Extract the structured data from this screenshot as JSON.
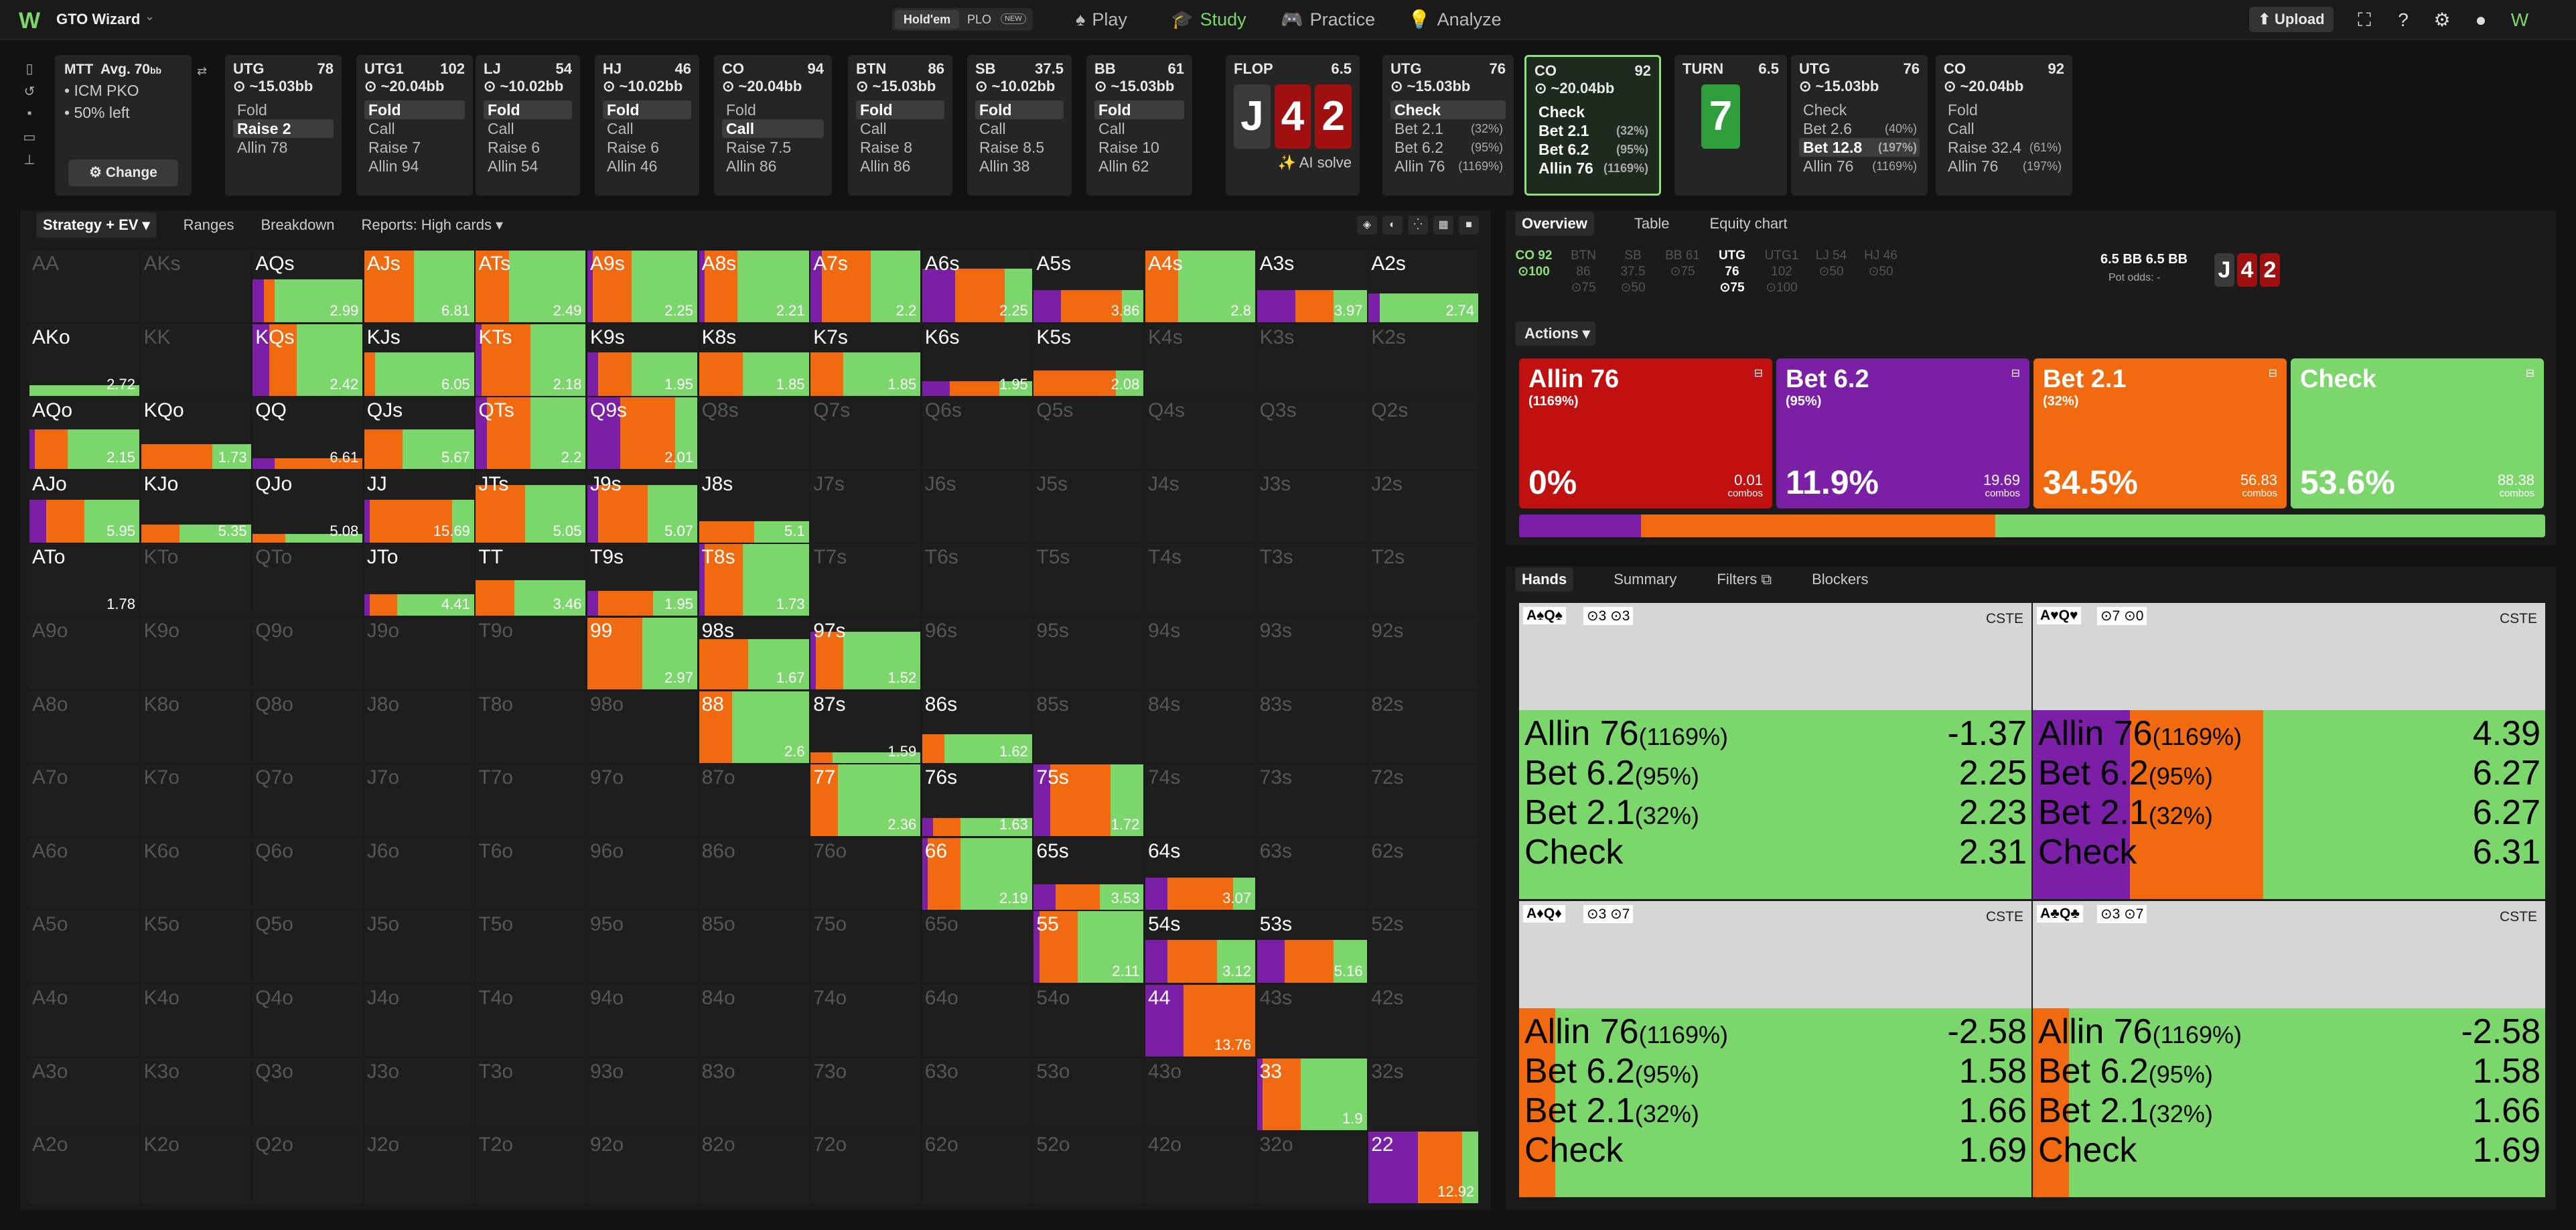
{
  "app": {
    "logo": "W",
    "title": "GTO Wizard",
    "mode_active": "Hold'em",
    "mode_other": "PLO",
    "mode_badge": "NEW"
  },
  "nav": [
    {
      "label": "Play",
      "icon": "spade-icon",
      "glyph": "♠"
    },
    {
      "label": "Study",
      "icon": "graduation-cap-icon",
      "glyph": "🎓"
    },
    {
      "label": "Practice",
      "icon": "gamepad-icon",
      "glyph": "🎮"
    },
    {
      "label": "Analyze",
      "icon": "bulb-icon",
      "glyph": "💡"
    }
  ],
  "toolbar": {
    "upload": "⬆ Upload"
  },
  "summary": {
    "title": "MTT",
    "avg": "Avg. 70",
    "avg_unit": "bb",
    "line1": "• ICM PKO",
    "line2": "• 50% left",
    "change": "⚙ Change"
  },
  "positions": [
    {
      "name": "UTG",
      "num": "78",
      "stack": "~15.03bb",
      "acts": [
        {
          "t": "Fold"
        },
        {
          "t": "Raise 2",
          "sel": true
        },
        {
          "t": "Allin 78"
        }
      ]
    },
    {
      "name": "UTG1",
      "num": "102",
      "stack": "~20.04bb",
      "acts": [
        {
          "t": "Fold",
          "sel": true
        },
        {
          "t": "Call"
        },
        {
          "t": "Raise 7"
        },
        {
          "t": "Allin 94"
        }
      ]
    },
    {
      "name": "LJ",
      "num": "54",
      "stack": "~10.02bb",
      "acts": [
        {
          "t": "Fold",
          "sel": true
        },
        {
          "t": "Call"
        },
        {
          "t": "Raise 6"
        },
        {
          "t": "Allin 54"
        }
      ]
    },
    {
      "name": "HJ",
      "num": "46",
      "stack": "~10.02bb",
      "acts": [
        {
          "t": "Fold",
          "sel": true
        },
        {
          "t": "Call"
        },
        {
          "t": "Raise 6"
        },
        {
          "t": "Allin 46"
        }
      ]
    },
    {
      "name": "CO",
      "num": "94",
      "stack": "~20.04bb",
      "acts": [
        {
          "t": "Fold"
        },
        {
          "t": "Call",
          "sel": true
        },
        {
          "t": "Raise 7.5"
        },
        {
          "t": "Allin 86"
        }
      ]
    },
    {
      "name": "BTN",
      "num": "86",
      "stack": "~15.03bb",
      "acts": [
        {
          "t": "Fold",
          "sel": true
        },
        {
          "t": "Call"
        },
        {
          "t": "Raise 8"
        },
        {
          "t": "Allin 86"
        }
      ]
    },
    {
      "name": "SB",
      "num": "37.5",
      "stack": "~10.02bb",
      "acts": [
        {
          "t": "Fold",
          "sel": true
        },
        {
          "t": "Call"
        },
        {
          "t": "Raise 8.5"
        },
        {
          "t": "Allin 38"
        }
      ]
    },
    {
      "name": "BB",
      "num": "61",
      "stack": "~15.03bb",
      "acts": [
        {
          "t": "Fold",
          "sel": true
        },
        {
          "t": "Call"
        },
        {
          "t": "Raise 10"
        },
        {
          "t": "Allin 62"
        }
      ]
    }
  ],
  "flop": {
    "label": "FLOP",
    "pot": "6.5",
    "cards": [
      "J",
      "4",
      "2"
    ],
    "ai": "✨ AI solve"
  },
  "utg_flop": {
    "name": "UTG",
    "num": "76",
    "stack": "~15.03bb",
    "acts": [
      {
        "t": "Check",
        "sel": true
      },
      {
        "t": "Bet 2.1",
        "p": "(32%)"
      },
      {
        "t": "Bet 6.2",
        "p": "(95%)"
      },
      {
        "t": "Allin 76",
        "p": "(1169%)"
      }
    ]
  },
  "co_flop": {
    "name": "CO",
    "num": "92",
    "stack": "~20.04bb",
    "acts": [
      {
        "t": "Check"
      },
      {
        "t": "Bet 2.1",
        "p": "(32%)"
      },
      {
        "t": "Bet 6.2",
        "p": "(95%)"
      },
      {
        "t": "Allin 76",
        "p": "(1169%)"
      }
    ]
  },
  "turn": {
    "label": "TURN",
    "pot": "6.5",
    "card": "7"
  },
  "utg_turn": {
    "name": "UTG",
    "num": "76",
    "stack": "~15.03bb",
    "acts": [
      {
        "t": "Check"
      },
      {
        "t": "Bet 2.6",
        "p": "(40%)"
      },
      {
        "t": "Bet 12.8",
        "p": "(197%)",
        "sel": true
      },
      {
        "t": "Allin 76",
        "p": "(1169%)"
      }
    ]
  },
  "co_turn": {
    "name": "CO",
    "num": "92",
    "stack": "~20.04bb",
    "acts": [
      {
        "t": "Fold"
      },
      {
        "t": "Call"
      },
      {
        "t": "Raise 32.4",
        "p": "(61%)"
      },
      {
        "t": "Allin 76",
        "p": "(197%)"
      }
    ]
  },
  "matrix_tabs": [
    "Strategy + EV ▾",
    "Ranges",
    "Breakdown",
    "Reports: High cards ▾"
  ],
  "matrix": {
    "ranks": [
      "A",
      "K",
      "Q",
      "J",
      "T",
      "9",
      "8",
      "7",
      "6",
      "5",
      "4",
      "3",
      "2"
    ],
    "colors": {
      "allin": "#7a1fa6",
      "bet": "#f26a10",
      "check": "#7bd66b",
      "allinred": "#c01010"
    },
    "cells": {
      "AQs": {
        "ev": "2.99",
        "h": 0.6,
        "s": [
          0.1,
          0.1,
          0.8
        ]
      },
      "AJs": {
        "ev": "6.81",
        "h": 1,
        "s": [
          0,
          0.45,
          0.55
        ]
      },
      "ATs": {
        "ev": "2.49",
        "h": 1,
        "s": [
          0,
          0.3,
          0.7
        ]
      },
      "A9s": {
        "ev": "2.25",
        "h": 1,
        "s": [
          0.05,
          0.35,
          0.6
        ]
      },
      "A8s": {
        "ev": "2.21",
        "h": 1,
        "s": [
          0.05,
          0.3,
          0.65
        ]
      },
      "A7s": {
        "ev": "2.2",
        "h": 1,
        "s": [
          0.1,
          0.45,
          0.45
        ]
      },
      "A6s": {
        "ev": "2.25",
        "h": 0.75,
        "s": [
          0.3,
          0.45,
          0.25
        ]
      },
      "A5s": {
        "ev": "3.86",
        "h": 0.45,
        "s": [
          0.25,
          0.55,
          0.2
        ]
      },
      "A4s": {
        "ev": "2.8",
        "h": 1,
        "s": [
          0,
          0.3,
          0.7
        ]
      },
      "A3s": {
        "ev": "3.97",
        "h": 0.45,
        "s": [
          0.35,
          0.35,
          0.3
        ]
      },
      "A2s": {
        "ev": "2.74",
        "h": 0.4,
        "s": [
          0.1,
          0,
          0.9
        ]
      },
      "AKo": {
        "ev": "2.72",
        "h": 0.15,
        "s": [
          0,
          0,
          1
        ]
      },
      "KQs": {
        "ev": "2.42",
        "h": 1,
        "s": [
          0.15,
          0.25,
          0.6
        ]
      },
      "KJs": {
        "ev": "6.05",
        "h": 0.6,
        "s": [
          0,
          0.1,
          0.9
        ]
      },
      "KTs": {
        "ev": "2.18",
        "h": 1,
        "s": [
          0.05,
          0.45,
          0.5
        ]
      },
      "K9s": {
        "ev": "1.95",
        "h": 0.6,
        "s": [
          0.1,
          0.3,
          0.6
        ]
      },
      "K8s": {
        "ev": "1.85",
        "h": 0.6,
        "s": [
          0,
          0.4,
          0.6
        ]
      },
      "K7s": {
        "ev": "1.85",
        "h": 0.6,
        "s": [
          0,
          0.3,
          0.7
        ]
      },
      "K6s": {
        "ev": "1.95",
        "h": 0.2,
        "s": [
          0.25,
          0.45,
          0.3
        ]
      },
      "K5s": {
        "ev": "2.08",
        "h": 0.35,
        "s": [
          0,
          0.75,
          0.25
        ]
      },
      "AQo": {
        "ev": "2.15",
        "h": 0.55,
        "s": [
          0.05,
          0.3,
          0.65
        ]
      },
      "KQo": {
        "ev": "1.73",
        "h": 0.35,
        "s": [
          0,
          0.65,
          0.35
        ]
      },
      "QQ": {
        "ev": "6.61",
        "h": 0.15,
        "s": [
          0.2,
          0.8,
          0
        ]
      },
      "QJs": {
        "ev": "5.67",
        "h": 0.55,
        "s": [
          0,
          0.35,
          0.65
        ]
      },
      "QTs": {
        "ev": "2.2",
        "h": 1,
        "s": [
          0.1,
          0.4,
          0.5
        ]
      },
      "Q9s": {
        "ev": "2.01",
        "h": 1,
        "s": [
          0.3,
          0.5,
          0.2
        ]
      },
      "AJo": {
        "ev": "5.95",
        "h": 0.6,
        "s": [
          0.15,
          0.35,
          0.5
        ]
      },
      "KJo": {
        "ev": "5.35",
        "h": 0.25,
        "s": [
          0,
          0.35,
          0.65
        ]
      },
      "QJo": {
        "ev": "5.08",
        "h": 0.12,
        "s": [
          0,
          0.3,
          0.7
        ]
      },
      "JJ": {
        "ev": "15.69",
        "h": 0.6,
        "s": [
          0.05,
          0.75,
          0.2
        ]
      },
      "JTs": {
        "ev": "5.05",
        "h": 0.8,
        "s": [
          0,
          0.45,
          0.55
        ]
      },
      "J9s": {
        "ev": "5.07",
        "h": 0.8,
        "s": [
          0.1,
          0.45,
          0.45
        ]
      },
      "J8s": {
        "ev": "5.1",
        "h": 0.3,
        "s": [
          0,
          0.5,
          0.5
        ]
      },
      "JTo": {
        "ev": "4.41",
        "h": 0.3,
        "s": [
          0.05,
          0.25,
          0.7
        ]
      },
      "TT": {
        "ev": "3.46",
        "h": 0.5,
        "s": [
          0,
          0.35,
          0.65
        ]
      },
      "T9s": {
        "ev": "1.95",
        "h": 0.35,
        "s": [
          0.1,
          0.5,
          0.4
        ]
      },
      "T8s": {
        "ev": "1.73",
        "h": 1,
        "s": [
          0.05,
          0.35,
          0.6
        ]
      },
      "99": {
        "ev": "2.97",
        "h": 1,
        "s": [
          0,
          0.5,
          0.5
        ]
      },
      "98s": {
        "ev": "1.67",
        "h": 0.7,
        "s": [
          0,
          0.45,
          0.55
        ]
      },
      "97s": {
        "ev": "1.52",
        "h": 0.8,
        "s": [
          0.05,
          0.25,
          0.7
        ]
      },
      "88": {
        "ev": "2.6",
        "h": 1,
        "s": [
          0,
          0.3,
          0.7
        ]
      },
      "87s": {
        "ev": "1.59",
        "h": 0.15,
        "s": [
          0,
          0.2,
          0.8
        ]
      },
      "86s": {
        "ev": "1.62",
        "h": 0.4,
        "s": [
          0,
          0.2,
          0.8
        ]
      },
      "77": {
        "ev": "2.36",
        "h": 1,
        "s": [
          0,
          0.25,
          0.75
        ]
      },
      "76s": {
        "ev": "1.63",
        "h": 0.25,
        "s": [
          0.1,
          0.25,
          0.65
        ]
      },
      "75s": {
        "ev": "1.72",
        "h": 1,
        "s": [
          0.15,
          0.55,
          0.3
        ]
      },
      "66": {
        "ev": "2.19",
        "h": 1,
        "s": [
          0.05,
          0.3,
          0.65
        ]
      },
      "65s": {
        "ev": "3.53",
        "h": 0.35,
        "s": [
          0.2,
          0.4,
          0.4
        ]
      },
      "64s": {
        "ev": "3.07",
        "h": 0.45,
        "s": [
          0.2,
          0.6,
          0.2
        ]
      },
      "55": {
        "ev": "2.11",
        "h": 1,
        "s": [
          0.05,
          0.35,
          0.6
        ]
      },
      "54s": {
        "ev": "3.12",
        "h": 0.6,
        "s": [
          0.2,
          0.45,
          0.35
        ]
      },
      "53s": {
        "ev": "5.16",
        "h": 0.6,
        "s": [
          0.25,
          0.45,
          0.3
        ]
      },
      "44": {
        "ev": "13.76",
        "h": 1,
        "s": [
          0.35,
          0.65,
          0
        ]
      },
      "33": {
        "ev": "1.9",
        "h": 1,
        "s": [
          0.05,
          0.35,
          0.6
        ]
      },
      "22": {
        "ev": "12.92",
        "h": 1,
        "s": [
          0.45,
          0.4,
          0.15
        ]
      },
      "ATo": {
        "ev": "1.78",
        "h": 0,
        "s": [
          0,
          0,
          0
        ]
      }
    }
  },
  "overview_tabs": [
    "Overview",
    "Table",
    "Equity chart"
  ],
  "pos_row": [
    {
      "n": "CO 92",
      "v": "⊙100",
      "c": "g"
    },
    {
      "n": "BTN 86",
      "v": "⊙75"
    },
    {
      "n": "SB 37.5",
      "v": "⊙50"
    },
    {
      "n": "BB 61",
      "v": "⊙75"
    },
    {
      "n": "UTG 76",
      "v": "⊙75",
      "c": "on"
    },
    {
      "n": "UTG1 102",
      "v": "⊙100"
    },
    {
      "n": "LJ 54",
      "v": "⊙50"
    },
    {
      "n": "HJ 46",
      "v": "⊙50"
    }
  ],
  "pot": {
    "main": "6.5 BB  6.5 BB",
    "odds": "Pot odds:  -"
  },
  "actions_label": "Actions ▾",
  "actions": [
    {
      "name": "Allin 76",
      "pct": "(1169%)",
      "val": "0%",
      "combos": "0.01",
      "color": "#c01010"
    },
    {
      "name": "Bet 6.2",
      "pct": "(95%)",
      "val": "11.9%",
      "combos": "19.69",
      "color": "#7a1fa6"
    },
    {
      "name": "Bet 2.1",
      "pct": "(32%)",
      "val": "34.5%",
      "combos": "56.83",
      "color": "#f26a10"
    },
    {
      "name": "Check",
      "pct": "",
      "val": "53.6%",
      "combos": "88.38",
      "color": "#7bd66b"
    }
  ],
  "strategy_bar": [
    0,
    11.9,
    34.5,
    53.6
  ],
  "combos_word": "combos",
  "hand_tabs": [
    "Hands",
    "Summary",
    "Filters ⧉",
    "Blockers"
  ],
  "hands": [
    {
      "name": "A♠Q♠",
      "bl": "⊙3 ⊙3",
      "cste": "CSTE",
      "stripes": [
        0,
        0,
        1
      ],
      "rows": [
        [
          "Allin 76",
          "(1169%)",
          "-1.37"
        ],
        [
          "Bet 6.2",
          "(95%)",
          "2.25"
        ],
        [
          "Bet 2.1",
          "(32%)",
          "2.23"
        ],
        [
          "Check",
          "",
          "2.31"
        ]
      ]
    },
    {
      "name": "A♥Q♥",
      "bl": "⊙7 ⊙0",
      "cste": "CSTE",
      "stripes": [
        0.19,
        0.26,
        0.55
      ],
      "rows": [
        [
          "Allin 76",
          "(1169%)",
          "4.39"
        ],
        [
          "Bet 6.2",
          "(95%)",
          "6.27"
        ],
        [
          "Bet 2.1",
          "(32%)",
          "6.27"
        ],
        [
          "Check",
          "",
          "6.31"
        ]
      ]
    },
    {
      "name": "A♦Q♦",
      "bl": "⊙3 ⊙7",
      "cste": "CSTE",
      "stripes": [
        0,
        0.07,
        0.93
      ],
      "rows": [
        [
          "Allin 76",
          "(1169%)",
          "-2.58"
        ],
        [
          "Bet 6.2",
          "(95%)",
          "1.58"
        ],
        [
          "Bet 2.1",
          "(32%)",
          "1.66"
        ],
        [
          "Check",
          "",
          "1.69"
        ]
      ]
    },
    {
      "name": "A♣Q♣",
      "bl": "⊙3 ⊙7",
      "cste": "CSTE",
      "stripes": [
        0,
        0.07,
        0.93
      ],
      "rows": [
        [
          "Allin 76",
          "(1169%)",
          "-2.58"
        ],
        [
          "Bet 6.2",
          "(95%)",
          "1.58"
        ],
        [
          "Bet 2.1",
          "(32%)",
          "1.66"
        ],
        [
          "Check",
          "",
          "1.69"
        ]
      ]
    }
  ]
}
